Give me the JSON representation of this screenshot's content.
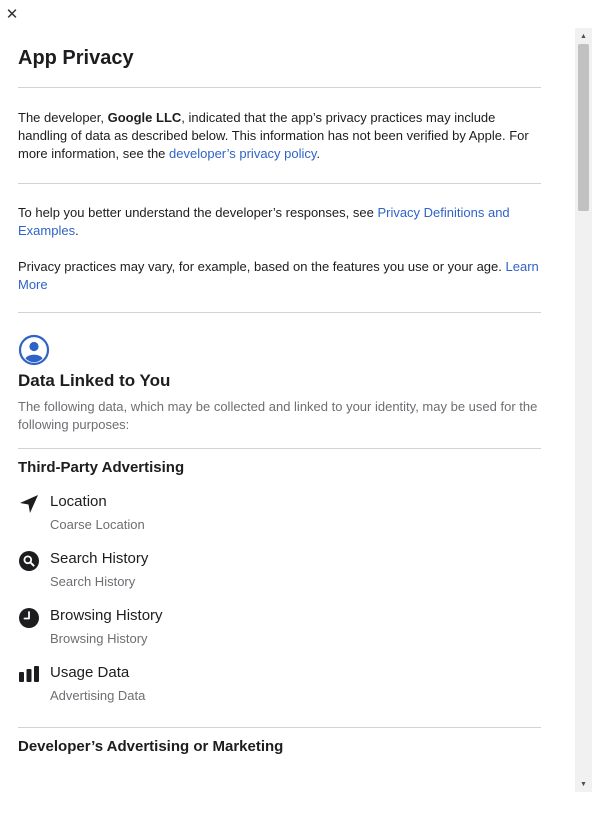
{
  "dialog": {
    "close_glyph": "✕",
    "title": "App Privacy"
  },
  "intro": {
    "prefix": "The developer, ",
    "developer": "Google LLC",
    "middle": ", indicated that the app’s privacy practices may include handling of data as described below. This information has not been verified by Apple. For more information, see the ",
    "policy_link": "developer’s privacy policy",
    "suffix": "."
  },
  "help": {
    "prefix": "To help you better understand the developer’s responses, see ",
    "definitions_link": "Privacy Definitions and Examples",
    "suffix": "."
  },
  "practices": {
    "text": "Privacy practices may vary, for example, based on the features you use or your age. ",
    "learn_more": "Learn More"
  },
  "linked_section": {
    "icon": "user-circle-icon",
    "title": "Data Linked to You",
    "description": "The following data, which may be collected and linked to your identity, may be used for the following purposes:",
    "accent_color": "#2f63c7"
  },
  "categories": [
    {
      "title": "Third-Party Advertising",
      "items": [
        {
          "icon": "location-arrow-icon",
          "label": "Location",
          "sub": "Coarse Location"
        },
        {
          "icon": "search-icon",
          "label": "Search History",
          "sub": "Search History"
        },
        {
          "icon": "clock-icon",
          "label": "Browsing History",
          "sub": "Browsing History"
        },
        {
          "icon": "bar-chart-icon",
          "label": "Usage Data",
          "sub": "Advertising Data"
        }
      ]
    },
    {
      "title": "Developer’s Advertising or Marketing"
    }
  ]
}
